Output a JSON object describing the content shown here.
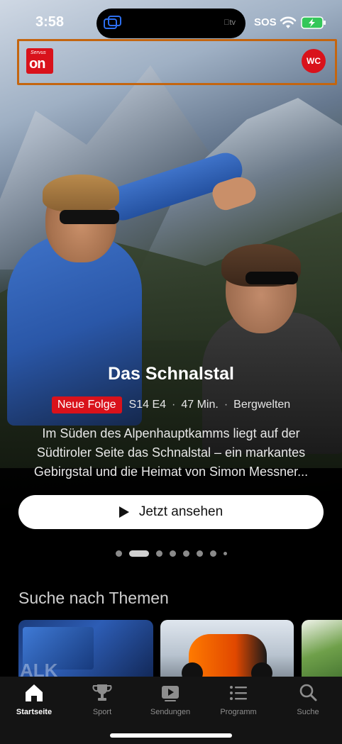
{
  "status_bar": {
    "time": "3:58",
    "island_label": "tv",
    "sos": "SOS",
    "icons": [
      "screen-mirror-icon",
      "wifi-icon",
      "battery-charging-icon"
    ]
  },
  "header": {
    "logo_top": "Servus",
    "logo_main": "on",
    "avatar_initials": "WC",
    "accent_color": "#d9121b",
    "highlight_color": "#c4650f"
  },
  "hero": {
    "title": "Das Schnalstal",
    "badge": "Neue Folge",
    "episode": "S14 E4",
    "duration": "47 Min.",
    "category": "Bergwelten",
    "description": "Im Süden des Alpenhauptkamms liegt auf der Südtiroler Seite das Schnalstal – ein markantes Gebirgstal und die Heimat von Simon Messner...",
    "watch_button": "Jetzt ansehen",
    "pager_total": 8,
    "pager_active": 1
  },
  "section": {
    "title": "Suche nach Themen"
  },
  "tabbar": {
    "items": [
      {
        "label": "Startseite",
        "icon": "home-icon",
        "active": true
      },
      {
        "label": "Sport",
        "icon": "trophy-icon",
        "active": false
      },
      {
        "label": "Sendungen",
        "icon": "play-screen-icon",
        "active": false
      },
      {
        "label": "Programm",
        "icon": "list-icon",
        "active": false
      },
      {
        "label": "Suche",
        "icon": "search-icon",
        "active": false
      }
    ]
  }
}
